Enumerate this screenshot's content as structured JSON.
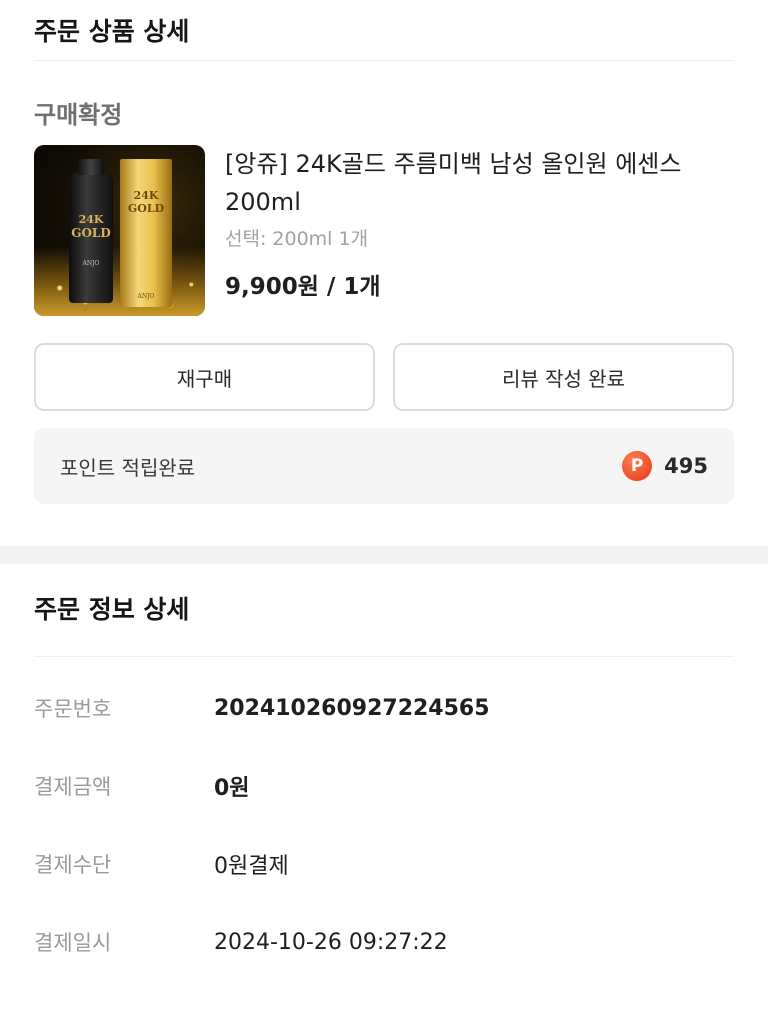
{
  "order_items": {
    "title": "주문 상품 상세",
    "status": "구매확정",
    "product": {
      "name": "[앙쥬] 24K골드 주름미백 남성 올인원 에센스 200ml",
      "option": "선택: 200ml 1개",
      "price": "9,900원 / 1개",
      "image_brand": "ANJO",
      "image_text": [
        "24K",
        "GOLD"
      ]
    },
    "buttons": {
      "rebuy": "재구매",
      "review": "리뷰 작성 완료"
    },
    "points": {
      "label": "포인트 적립완료",
      "icon": "P",
      "value": "495",
      "icon_color": "#e8461d"
    }
  },
  "order_info": {
    "title": "주문 정보 상세",
    "rows": [
      {
        "label": "주문번호",
        "value": "20241026092722​4565"
      },
      {
        "label": "결제금액",
        "value": "0원"
      },
      {
        "label": "결제수단",
        "value": "0원결제"
      },
      {
        "label": "결제일시",
        "value": "2024-10-26 09:27:22"
      }
    ]
  }
}
